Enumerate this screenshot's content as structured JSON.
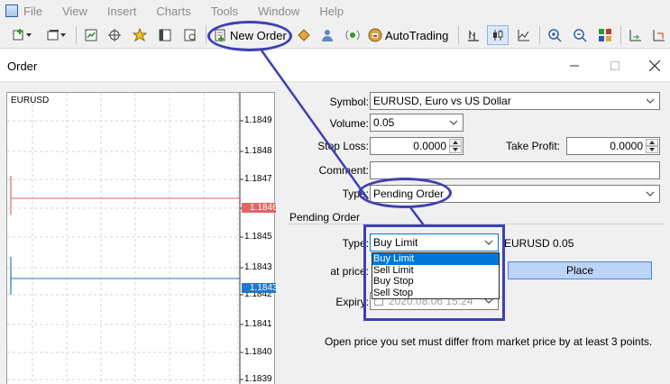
{
  "menu": {
    "items": [
      "File",
      "View",
      "Insert",
      "Charts",
      "Tools",
      "Window",
      "Help"
    ]
  },
  "toolbar": {
    "new_order_label": "New Order",
    "autotrading_label": "AutoTrading"
  },
  "window": {
    "title": "Order"
  },
  "chart": {
    "symbol": "EURUSD",
    "ticks": [
      "1.1849",
      "1.1848",
      "1.1847",
      "1.1846",
      "1.1845",
      "1.1843",
      "1.1842",
      "1.1841",
      "1.1840",
      "1.1839"
    ],
    "ask_price": "1.1846",
    "bid_price": "1.1843",
    "ask_color": "#e06666",
    "bid_color": "#1f78c8"
  },
  "form": {
    "symbol_label": "Symbol:",
    "symbol_value": "EURUSD, Euro vs US Dollar",
    "volume_label": "Volume:",
    "volume_value": "0.05",
    "stop_loss_label": "Stop Loss:",
    "stop_loss_value": "0.0000",
    "take_profit_label": "Take Profit:",
    "take_profit_value": "0.0000",
    "comment_label": "Comment:",
    "comment_value": "",
    "type_label": "Type:",
    "type_value": "Pending Order"
  },
  "pending": {
    "group_title": "Pending Order",
    "type_label": "Type:",
    "type_value": "Buy Limit",
    "summary": "EURUSD 0.05",
    "at_price_label": "at price:",
    "place_label": "Place",
    "expiry_label": "Expiry:",
    "expiry_value": "2020.08.06 15:24",
    "options": [
      "Buy Limit",
      "Sell Limit",
      "Buy Stop",
      "Sell Stop"
    ],
    "hint": "Open price you set must differ from market price by at least 3 points."
  },
  "colors": {
    "annotation": "#3e40b2",
    "selection": "#0078d7"
  }
}
